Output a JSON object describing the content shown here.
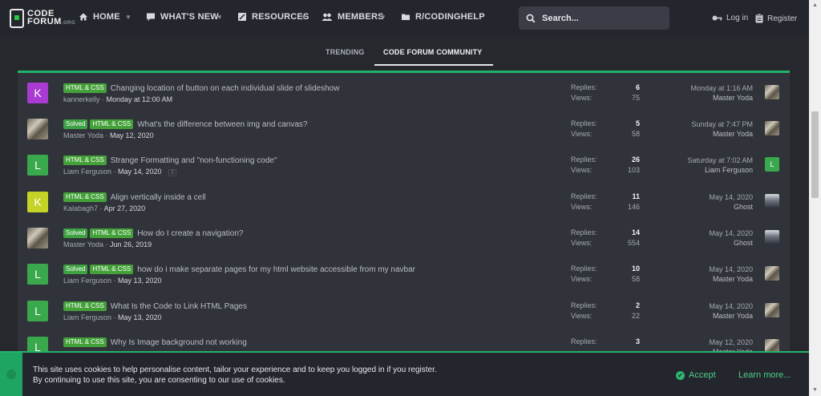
{
  "brand": {
    "line1": "CODE",
    "line2": "FORUM",
    "suffix": ".ORG"
  },
  "nav": [
    {
      "label": "HOME"
    },
    {
      "label": "WHAT'S NEW"
    },
    {
      "label": "RESOURCES"
    },
    {
      "label": "MEMBERS"
    },
    {
      "label": "R/CODINGHELP"
    }
  ],
  "search": {
    "placeholder": "Search..."
  },
  "auth": {
    "login": "Log in",
    "register": "Register"
  },
  "subnav": {
    "tab1": "TRENDING",
    "tab2": "CODE FORUM COMMUNITY"
  },
  "threads": [
    {
      "avatar_letter": "K",
      "badges": [
        "HTML & CSS"
      ],
      "title": "Changing location of button on each individual slide of slideshow",
      "author": "kannerkelly",
      "date": "Monday at 12:00 AM",
      "pages": "",
      "replies_label": "Replies:",
      "replies": "6",
      "views_label": "Views:",
      "views": "75",
      "last_date": "Monday at 1:16 AM",
      "last_user": "Master Yoda"
    },
    {
      "avatar_letter": "",
      "badges": [
        "Solved",
        "HTML & CSS"
      ],
      "title": "What's the difference between img and canvas?",
      "author": "Master Yoda",
      "date": "May 12, 2020",
      "pages": "",
      "replies_label": "Replies:",
      "replies": "5",
      "views_label": "Views:",
      "views": "58",
      "last_date": "Sunday at 7:47 PM",
      "last_user": "Master Yoda"
    },
    {
      "avatar_letter": "L",
      "badges": [
        "HTML & CSS"
      ],
      "title": "Strange Formatting and \"non-functioning code\"",
      "author": "Liam Ferguson",
      "date": "May 14, 2020",
      "pages": "2",
      "replies_label": "Replies:",
      "replies": "26",
      "views_label": "Views:",
      "views": "103",
      "last_date": "Saturday at 7:02 AM",
      "last_user": "Liam Ferguson",
      "last_avatar_letter": "L"
    },
    {
      "avatar_letter": "K",
      "badges": [
        "HTML & CSS"
      ],
      "title": "Align vertically inside a cell",
      "author": "Kalabagh7",
      "date": "Apr 27, 2020",
      "pages": "",
      "replies_label": "Replies:",
      "replies": "11",
      "views_label": "Views:",
      "views": "146",
      "last_date": "May 14, 2020",
      "last_user": "Ghost"
    },
    {
      "avatar_letter": "",
      "badges": [
        "Solved",
        "HTML & CSS"
      ],
      "title": "How do I create a navigation?",
      "author": "Master Yoda",
      "date": "Jun 26, 2019",
      "pages": "",
      "replies_label": "Replies:",
      "replies": "14",
      "views_label": "Views:",
      "views": "554",
      "last_date": "May 14, 2020",
      "last_user": "Ghost"
    },
    {
      "avatar_letter": "L",
      "badges": [
        "Solved",
        "HTML & CSS"
      ],
      "title": "how do i make separate pages for my html website accessible from my navbar",
      "author": "Liam Ferguson",
      "date": "May 13, 2020",
      "pages": "",
      "replies_label": "Replies:",
      "replies": "10",
      "views_label": "Views:",
      "views": "58",
      "last_date": "May 14, 2020",
      "last_user": "Master Yoda"
    },
    {
      "avatar_letter": "L",
      "badges": [
        "HTML & CSS"
      ],
      "title": "What Is the Code to Link HTML Pages",
      "author": "Liam Ferguson",
      "date": "May 13, 2020",
      "pages": "",
      "replies_label": "Replies:",
      "replies": "2",
      "views_label": "Views:",
      "views": "22",
      "last_date": "May 14, 2020",
      "last_user": "Master Yoda"
    },
    {
      "avatar_letter": "L",
      "badges": [
        "HTML & CSS"
      ],
      "title": "Why Is Image background not working",
      "author": "",
      "date": "",
      "pages": "",
      "replies_label": "Replies:",
      "replies": "3",
      "views_label": "",
      "views": "",
      "last_date": "May 12, 2020",
      "last_user": "Master Yoda"
    }
  ],
  "cookie": {
    "line1": "This site uses cookies to help personalise content, tailor your experience and to keep you logged in if you register.",
    "line2": "By continuing to use this site, you are consenting to our use of cookies.",
    "accept": "Accept",
    "learn_more": "Learn more..."
  },
  "colors": {
    "accent": "#21b36b",
    "badge": "#44a13a",
    "panel": "#31333a",
    "background": "#26282e"
  }
}
